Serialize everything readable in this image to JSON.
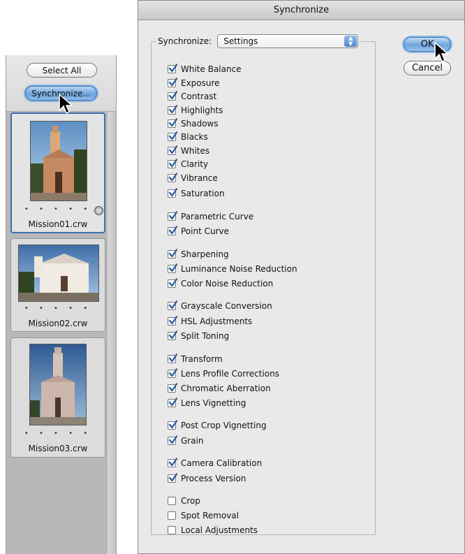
{
  "dialog": {
    "title": "Synchronize",
    "sync_label": "Synchronize:",
    "sync_value": "Settings",
    "ok_label": "OK",
    "cancel_label": "Cancel"
  },
  "settings": [
    {
      "label": "White Balance",
      "checked": true
    },
    {
      "label": "Exposure",
      "checked": true
    },
    {
      "label": "Contrast",
      "checked": true
    },
    {
      "label": "Highlights",
      "checked": true
    },
    {
      "label": "Shadows",
      "checked": true
    },
    {
      "label": "Blacks",
      "checked": true
    },
    {
      "label": "Whites",
      "checked": true
    },
    {
      "label": "Clarity",
      "checked": true
    },
    {
      "label": "Vibrance",
      "checked": true
    },
    {
      "label": "Saturation",
      "checked": true
    },
    {
      "label": "Parametric Curve",
      "checked": true
    },
    {
      "label": "Point Curve",
      "checked": true
    },
    {
      "label": "Sharpening",
      "checked": true
    },
    {
      "label": "Luminance Noise Reduction",
      "checked": true
    },
    {
      "label": "Color Noise Reduction",
      "checked": true
    },
    {
      "label": "Grayscale Conversion",
      "checked": true
    },
    {
      "label": "HSL Adjustments",
      "checked": true
    },
    {
      "label": "Split Toning",
      "checked": true
    },
    {
      "label": "Transform",
      "checked": true
    },
    {
      "label": "Lens Profile Corrections",
      "checked": true
    },
    {
      "label": "Chromatic Aberration",
      "checked": true
    },
    {
      "label": "Lens Vignetting",
      "checked": true
    },
    {
      "label": "Post Crop Vignetting",
      "checked": true
    },
    {
      "label": "Grain",
      "checked": true
    },
    {
      "label": "Camera Calibration",
      "checked": true
    },
    {
      "label": "Process Version",
      "checked": true
    },
    {
      "label": "Crop",
      "checked": false
    },
    {
      "label": "Spot Removal",
      "checked": false
    },
    {
      "label": "Local Adjustments",
      "checked": false
    }
  ],
  "filmstrip": {
    "select_all_label": "Select All",
    "synchronize_label": "Synchronize...",
    "thumbnails": [
      {
        "filename": "Mission01.crw",
        "rating_dots": "• • • • •",
        "selected": true
      },
      {
        "filename": "Mission02.crw",
        "rating_dots": "• • • • •",
        "selected": false
      },
      {
        "filename": "Mission03.crw",
        "rating_dots": "• • • • •",
        "selected": false
      }
    ]
  },
  "colors": {
    "accent_blue": "#6ea4dc",
    "dialog_bg": "#e9e9e9",
    "checkbox_check": "#2c5fa6"
  }
}
